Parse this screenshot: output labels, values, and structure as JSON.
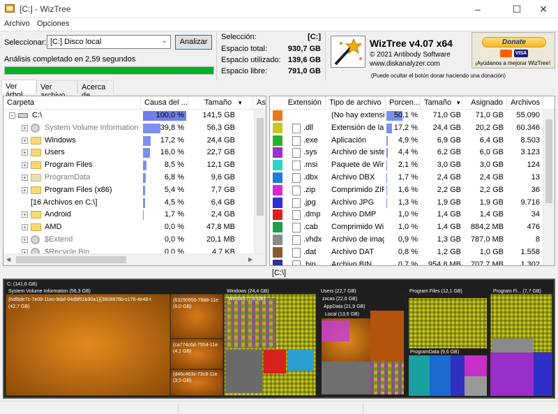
{
  "window": {
    "title": "[C:] - WizTree",
    "minimize": "–",
    "maximize": "☐",
    "close": "✕"
  },
  "menu": [
    "Archivo",
    "Opciones"
  ],
  "scan": {
    "select_label": "Seleccionar:",
    "drive": "[C:] Disco local",
    "analyze_label": "Analizar",
    "status": "Análisis completado en 2,59 segundos",
    "progress_fraction": 1.0
  },
  "stats": {
    "selection_label": "Selección:",
    "selection_value": "[C:]",
    "total_label": "Espacio total:",
    "total_value": "930,7 GB",
    "used_label": "Espacio utilizado:",
    "used_value": "139,6 GB",
    "free_label": "Espacio libre:",
    "free_value": "791,0 GB"
  },
  "brand": {
    "title": "WizTree v4.07 x64",
    "copyright": "© 2021 Antibody Software",
    "url": "www.diskanalyzer.com",
    "hint": "(Puede ocultar el botón donar haciendo una donación)",
    "donate_label": "Donate",
    "card_label": "VISA",
    "donate_help": "¡Ayúdanos a mejorar WizTree!"
  },
  "tabs": [
    "Ver árbol",
    "Ver archivo",
    "Acerca de"
  ],
  "tree": {
    "headers": [
      "Carpeta",
      "Causa del ...",
      "Tamaño",
      "As"
    ],
    "rows": [
      {
        "name": "C:\\",
        "pct": "100,0 %",
        "pctv": 1.0,
        "size": "141,5 GB",
        "icon": "drive",
        "dim": false,
        "expand": "−",
        "level": 0
      },
      {
        "name": "System Volume Information",
        "pct": "39,8 %",
        "pctv": 0.398,
        "size": "56,3 GB",
        "icon": "gear",
        "dim": true,
        "expand": "+",
        "level": 1
      },
      {
        "name": "Windows",
        "pct": "17,2 %",
        "pctv": 0.172,
        "size": "24,4 GB",
        "icon": "folder",
        "dim": false,
        "expand": "+",
        "level": 1
      },
      {
        "name": "Users",
        "pct": "16,0 %",
        "pctv": 0.16,
        "size": "22,7 GB",
        "icon": "folder",
        "dim": false,
        "expand": "+",
        "level": 1
      },
      {
        "name": "Program Files",
        "pct": "8,5 %",
        "pctv": 0.085,
        "size": "12,1 GB",
        "icon": "folder",
        "dim": false,
        "expand": "+",
        "level": 1
      },
      {
        "name": "ProgramData",
        "pct": "6,8 %",
        "pctv": 0.068,
        "size": "9,6 GB",
        "icon": "folder-gray",
        "dim": true,
        "expand": "+",
        "level": 1
      },
      {
        "name": "Program Files (x86)",
        "pct": "5,4 %",
        "pctv": 0.054,
        "size": "7,7 GB",
        "icon": "folder",
        "dim": false,
        "expand": "+",
        "level": 1
      },
      {
        "name": "[16 Archivos en C:\\]",
        "pct": "4,5 %",
        "pctv": 0.045,
        "size": "6,4 GB",
        "icon": "none",
        "dim": false,
        "expand": "",
        "level": 1
      },
      {
        "name": "Android",
        "pct": "1,7 %",
        "pctv": 0.017,
        "size": "2,4 GB",
        "icon": "folder",
        "dim": false,
        "expand": "+",
        "level": 1
      },
      {
        "name": "AMD",
        "pct": "0,0 %",
        "pctv": 0.0,
        "size": "47,8 MB",
        "icon": "folder",
        "dim": false,
        "expand": "+",
        "level": 1
      },
      {
        "name": "$Extend",
        "pct": "0,0 %",
        "pctv": 0.0,
        "size": "20,1 MB",
        "icon": "gear",
        "dim": true,
        "expand": "+",
        "level": 1
      },
      {
        "name": "$Recycle.Bin",
        "pct": "0,0 %",
        "pctv": 0.0,
        "size": "4,7 KB",
        "icon": "gear",
        "dim": true,
        "expand": "+",
        "level": 1
      }
    ]
  },
  "extensions": {
    "headers": [
      "Extensión",
      "Tipo de archivo",
      "Porcen...",
      "Tamaño",
      "Asignado",
      "Archivos"
    ],
    "rows": [
      {
        "ext": "",
        "type": "(No hay extensió",
        "pct": "50,1 %",
        "pctv": 0.501,
        "size": "71,0 GB",
        "alloc": "71,0 GB",
        "files": "55.090",
        "color": "#e8791a"
      },
      {
        "ext": ".dll",
        "type": "Extensión de la a",
        "pct": "17,2 %",
        "pctv": 0.172,
        "size": "24,4 GB",
        "alloc": "20,2 GB",
        "files": "60.346",
        "color": "#c8c81c"
      },
      {
        "ext": ".exe",
        "type": "Aplicación",
        "pct": "4,9 %",
        "pctv": 0.049,
        "size": "6,9 GB",
        "alloc": "6,4 GB",
        "files": "8.503",
        "color": "#29b329"
      },
      {
        "ext": ".sys",
        "type": "Archivo de sister",
        "pct": "4,4 %",
        "pctv": 0.044,
        "size": "6,2 GB",
        "alloc": "6,0 GB",
        "files": "3.123",
        "color": "#9a32cd"
      },
      {
        "ext": ".msi",
        "type": "Paquete de Winc",
        "pct": "2,1 %",
        "pctv": 0.021,
        "size": "3,0 GB",
        "alloc": "3,0 GB",
        "files": "124",
        "color": "#2ad4c8"
      },
      {
        "ext": ".dbx",
        "type": "Archivo DBX",
        "pct": "1,7 %",
        "pctv": 0.017,
        "size": "2,4 GB",
        "alloc": "2,4 GB",
        "files": "13",
        "color": "#1e7bd6"
      },
      {
        "ext": ".zip",
        "type": "Comprimido ZIF",
        "pct": "1,6 %",
        "pctv": 0.016,
        "size": "2,2 GB",
        "alloc": "2,2 GB",
        "files": "36",
        "color": "#d62ad6"
      },
      {
        "ext": ".jpg",
        "type": "Archivo JPG",
        "pct": "1,3 %",
        "pctv": 0.013,
        "size": "1,9 GB",
        "alloc": "1,9 GB",
        "files": "9.716",
        "color": "#3030d8"
      },
      {
        "ext": ".dmp",
        "type": "Archivo DMP",
        "pct": "1,0 %",
        "pctv": 0.01,
        "size": "1,4 GB",
        "alloc": "1,4 GB",
        "files": "34",
        "color": "#e01e1e"
      },
      {
        "ext": ".cab",
        "type": "Comprimido Wi",
        "pct": "1,0 %",
        "pctv": 0.01,
        "size": "1,4 GB",
        "alloc": "884,2 MB",
        "files": "476",
        "color": "#1b9e4a"
      },
      {
        "ext": ".vhdx",
        "type": "Archivo de imag",
        "pct": "0,9 %",
        "pctv": 0.009,
        "size": "1,3 GB",
        "alloc": "787,0 MB",
        "files": "8",
        "color": "#8a8a8a"
      },
      {
        "ext": ".dat",
        "type": "Archivo DAT",
        "pct": "0,8 %",
        "pctv": 0.008,
        "size": "1,2 GB",
        "alloc": "1,0 GB",
        "files": "1.558",
        "color": "#8b5a2b"
      },
      {
        "ext": ".bin",
        "type": "Archivo BIN",
        "pct": "0,7 %",
        "pctv": 0.007,
        "size": "954,8 MB",
        "alloc": "707,7 MB",
        "files": "1.302",
        "color": "#2f2f8f"
      }
    ]
  },
  "path_label": "[C:\\]",
  "treemap": {
    "root": "C: (141,6 GB)",
    "labels": {
      "svi": "System Volume Information (56,3 GB)",
      "svi_a": "{6df8de7c-7e09-11ec-9daf-04d9f51b30a1}{3808876b-c176-4e48-t",
      "svi_a2": "(42,7 GB)",
      "svi_b": "{63290950-7888-11e",
      "svi_b2": "(6,0 GB)",
      "svi_c": "{ca774c6d-7554-11e",
      "svi_c2": "(4,1 GB)",
      "svi_d": "{d46c463c-73c8-11e",
      "svi_d2": "(3,5 GB)",
      "win": "Windows (24,4 GB)",
      "winsxs": "WinSxS (7,6 GB)",
      "users": "Users (22,7 GB)",
      "zxcas": "zxcas (22,6 GB)",
      "appdata": "AppData (21,9 GB)",
      "local": "Local (13,6 GB)",
      "pf": "Program Files (12,1 GB)",
      "pfx": "Program Fi... (7,7 GB)",
      "pd": "ProgramData (9,6 GB)"
    }
  }
}
